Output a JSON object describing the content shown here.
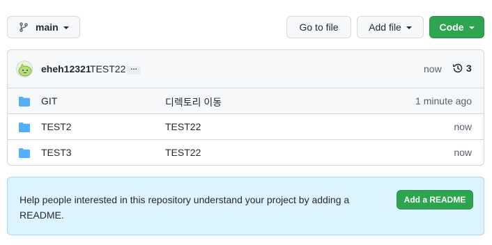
{
  "toolbar": {
    "branch_label": "main",
    "goto_file_label": "Go to file",
    "add_file_label": "Add file",
    "code_label": "Code"
  },
  "latest_commit": {
    "author": "eheh12321",
    "message": "TEST22",
    "ellipsis": "…",
    "time": "now",
    "history_count": "3"
  },
  "files": [
    {
      "name": "GIT",
      "commit_message": "디렉토리 이동",
      "time": "1 minute ago",
      "icon": "folder-icon"
    },
    {
      "name": "TEST2",
      "commit_message": "TEST22",
      "time": "now",
      "icon": "folder-icon"
    },
    {
      "name": "TEST3",
      "commit_message": "TEST22",
      "time": "now",
      "icon": "folder-icon"
    }
  ],
  "readme_prompt": {
    "text": "Help people interested in this repository understand your project by adding a README.",
    "button_label": "Add a README"
  },
  "colors": {
    "accent_green": "#2da44e",
    "folder_blue": "#54aeff",
    "readme_bg": "#ddf4ff"
  }
}
